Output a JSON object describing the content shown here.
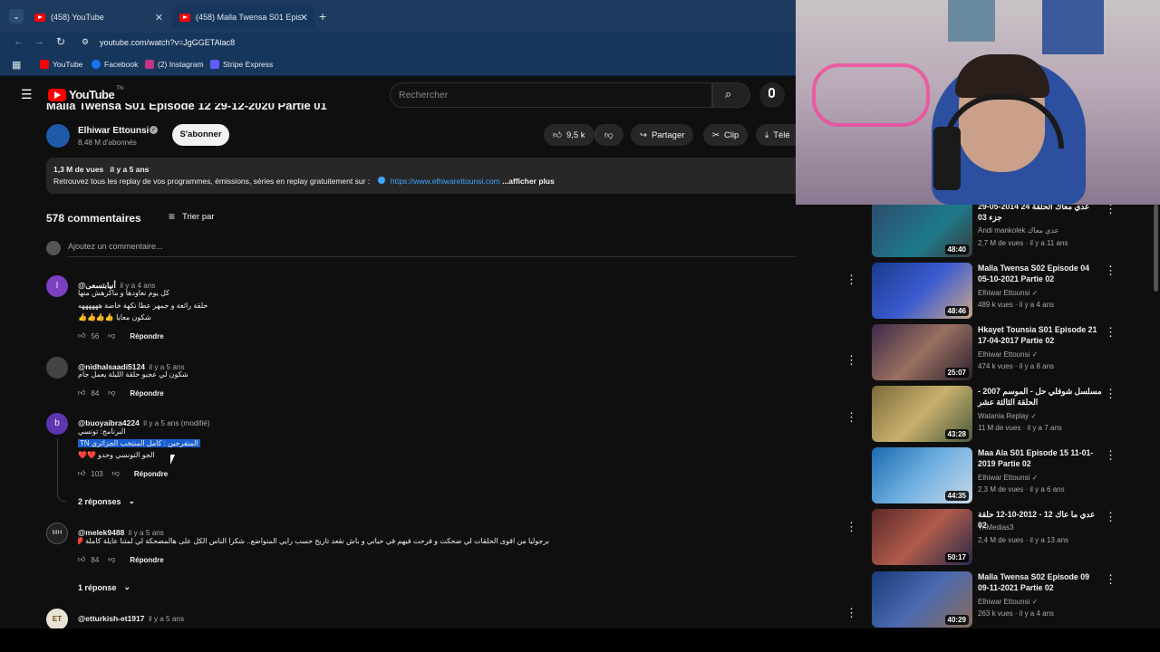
{
  "browser": {
    "tabs": [
      {
        "label": "(458) YouTube",
        "active": false
      },
      {
        "label": "(458) Malla Twensa S01 Episod",
        "active": true
      }
    ],
    "url": "youtube.com/watch?v=JgGGETAlac8",
    "bookmarks": [
      "YouTube",
      "Facebook",
      "(2) Instagram",
      "Stripe Express"
    ]
  },
  "yt": {
    "logo_text": "YouTube",
    "logo_country": "TN",
    "search_placeholder": "Rechercher"
  },
  "video": {
    "title_partial": "Malla Twensa S01 Episode 12 29-12-2020 Partie 01",
    "channel": "Elhiwar Ettounsi",
    "subscribers": "8,48 M d'abonnés",
    "subscribe_label": "S'abonner",
    "likes": "9,5 k",
    "share_label": "Partager",
    "clip_label": "Clip",
    "download_label": "Télé",
    "views_date": "1,3 M de vues   il y a 5 ans",
    "description": "Retrouvez tous les replay de vos programmes, émissions, séries en replay gratuitement sur :",
    "description_link": "https://www.elhiwarettounsi.com",
    "show_more": "...afficher plus"
  },
  "comments": {
    "count_label": "578 commentaires",
    "sort_label": "Trier par",
    "add_placeholder": "Ajoutez un commentaire...",
    "reply_label": "Répondre",
    "items": [
      {
        "author": "@أنيابتسعى",
        "time": "il y a 4 ans",
        "avatar_letter": "I",
        "lines": [
          "كل يوم نعاودها و ماكرهش منها",
          "حلقة رائعة و جمهر عطا نكهة خاصة ههههههه",
          "شكون معايا 👍👍👍👍"
        ],
        "likes": "56"
      },
      {
        "author": "@nidhalsaadi5124",
        "time": "il y a 5 ans",
        "avatar_letter": "",
        "lines": [
          "شكون لي عجبو حلقة الليلة يعمل جام"
        ],
        "likes": "84"
      },
      {
        "author": "@buoyaibra4224",
        "time": "il y a 5 ans (modifié)",
        "avatar_letter": "b",
        "lines": [
          "البرنامج: تونسي",
          "المتفرجين : كامل المنتخب الجزائري TN",
          "الجو التونسي وحدو ❤️❤️"
        ],
        "likes": "103",
        "replies_label": "2 réponses"
      },
      {
        "author": "@melek9488",
        "time": "il y a 5 ans",
        "avatar_letter": "MH",
        "lines": [
          "برجوليا من اقوى الحلقات لي ضحكت و  فرحت فيهم في حياتي و باش نقعد تاريخ حسب رايي المتواضع.. شكرا الناس الكل على هالمضحكة لي لمتنا عايلة كاملة ❤️❤️❤️🙏"
        ],
        "likes": "84",
        "replies_label": "1 réponse"
      },
      {
        "author": "@etturkish-et1917",
        "time": "il y a 5 ans",
        "avatar_letter": "ET",
        "lines": [
          ""
        ],
        "likes": ""
      }
    ]
  },
  "recommendations": [
    {
      "title": "عدي معاك الحلقة 24 2014-05-29 جزء 03",
      "channel": "Andi mankolek عدي معاك",
      "meta": "2,7 M de vues · il y a 11 ans",
      "duration": "48:40",
      "verified": false
    },
    {
      "title": "Malla Twensa S02 Episode 04 05-10-2021 Partie 02",
      "channel": "Elhiwar Ettounsi",
      "meta": "489 k vues · il y a 4 ans",
      "duration": "48:46",
      "verified": true
    },
    {
      "title": "Hkayet Tounsia S01 Episode 21 17-04-2017 Partie 02",
      "channel": "Elhiwar Ettounsi",
      "meta": "474 k vues · il y a 8 ans",
      "duration": "25:07",
      "verified": true
    },
    {
      "title": "مسلسل شوفلي حل - الموسم 2007 - الحلقة الثالثة عشر",
      "channel": "Watania Replay",
      "meta": "11 M de vues · il y a 7 ans",
      "duration": "43:28",
      "verified": true
    },
    {
      "title": "Maa Ala S01 Episode 15 11-01-2019 Partie 02",
      "channel": "Elhiwar Ettounsi",
      "meta": "2,3 M de vues · il y a 6 ans",
      "duration": "44:35",
      "verified": true
    },
    {
      "title": "عدي ما عاك 12 - 2012-10-12 حلقة 02",
      "channel": "TnMedias3",
      "meta": "2,4 M de vues · il y a 13 ans",
      "duration": "50:17",
      "verified": false
    },
    {
      "title": "Malla Twensa S02 Episode 09 09-11-2021 Partie 02",
      "channel": "Elhiwar Ettounsi",
      "meta": "263 k vues · il y a 4 ans",
      "duration": "40:29",
      "verified": true
    }
  ]
}
